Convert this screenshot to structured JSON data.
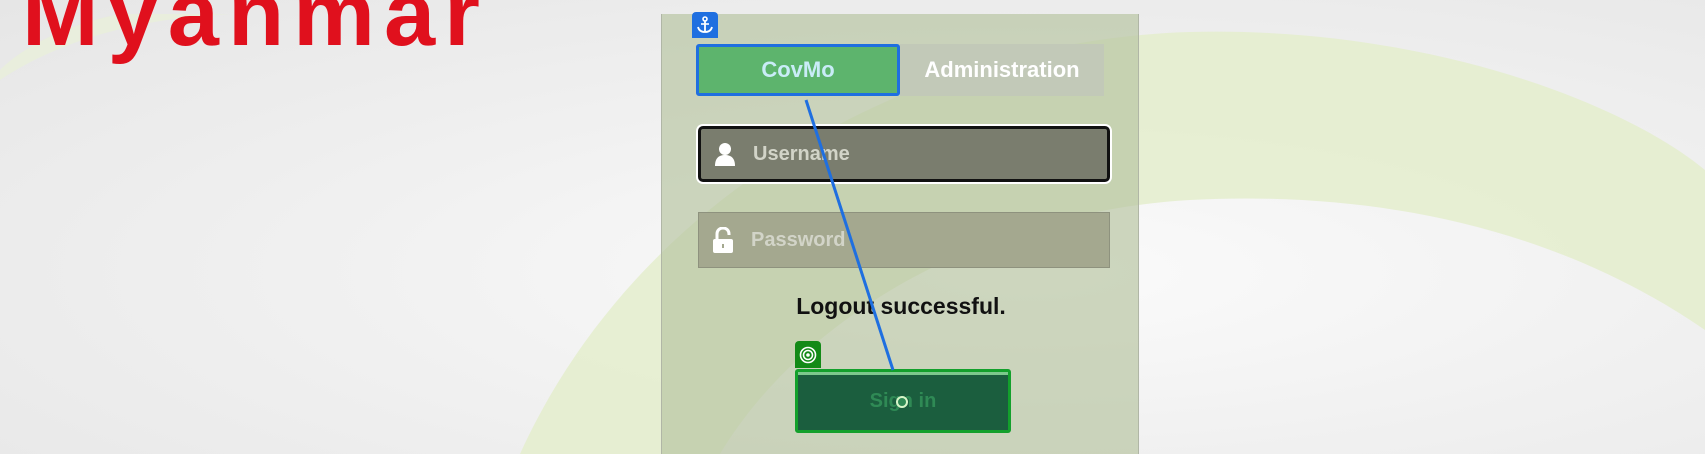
{
  "brand": {
    "name": "Myanmar",
    "color": "#e0101d"
  },
  "login": {
    "tabs": [
      {
        "label": "CovMo",
        "selected": true
      },
      {
        "label": "Administration",
        "selected": false
      }
    ],
    "username": {
      "placeholder": "Username",
      "value": "",
      "icon": "user-icon"
    },
    "password": {
      "placeholder": "Password",
      "value": "",
      "icon": "lock-icon"
    },
    "status_message": "Logout successful.",
    "signin_label": "Sign in"
  },
  "overlay": {
    "anchor_icon": "anchor-icon",
    "target_icon": "target-icon",
    "anchor_color": "#1f6fe0",
    "target_color": "#138a17"
  }
}
